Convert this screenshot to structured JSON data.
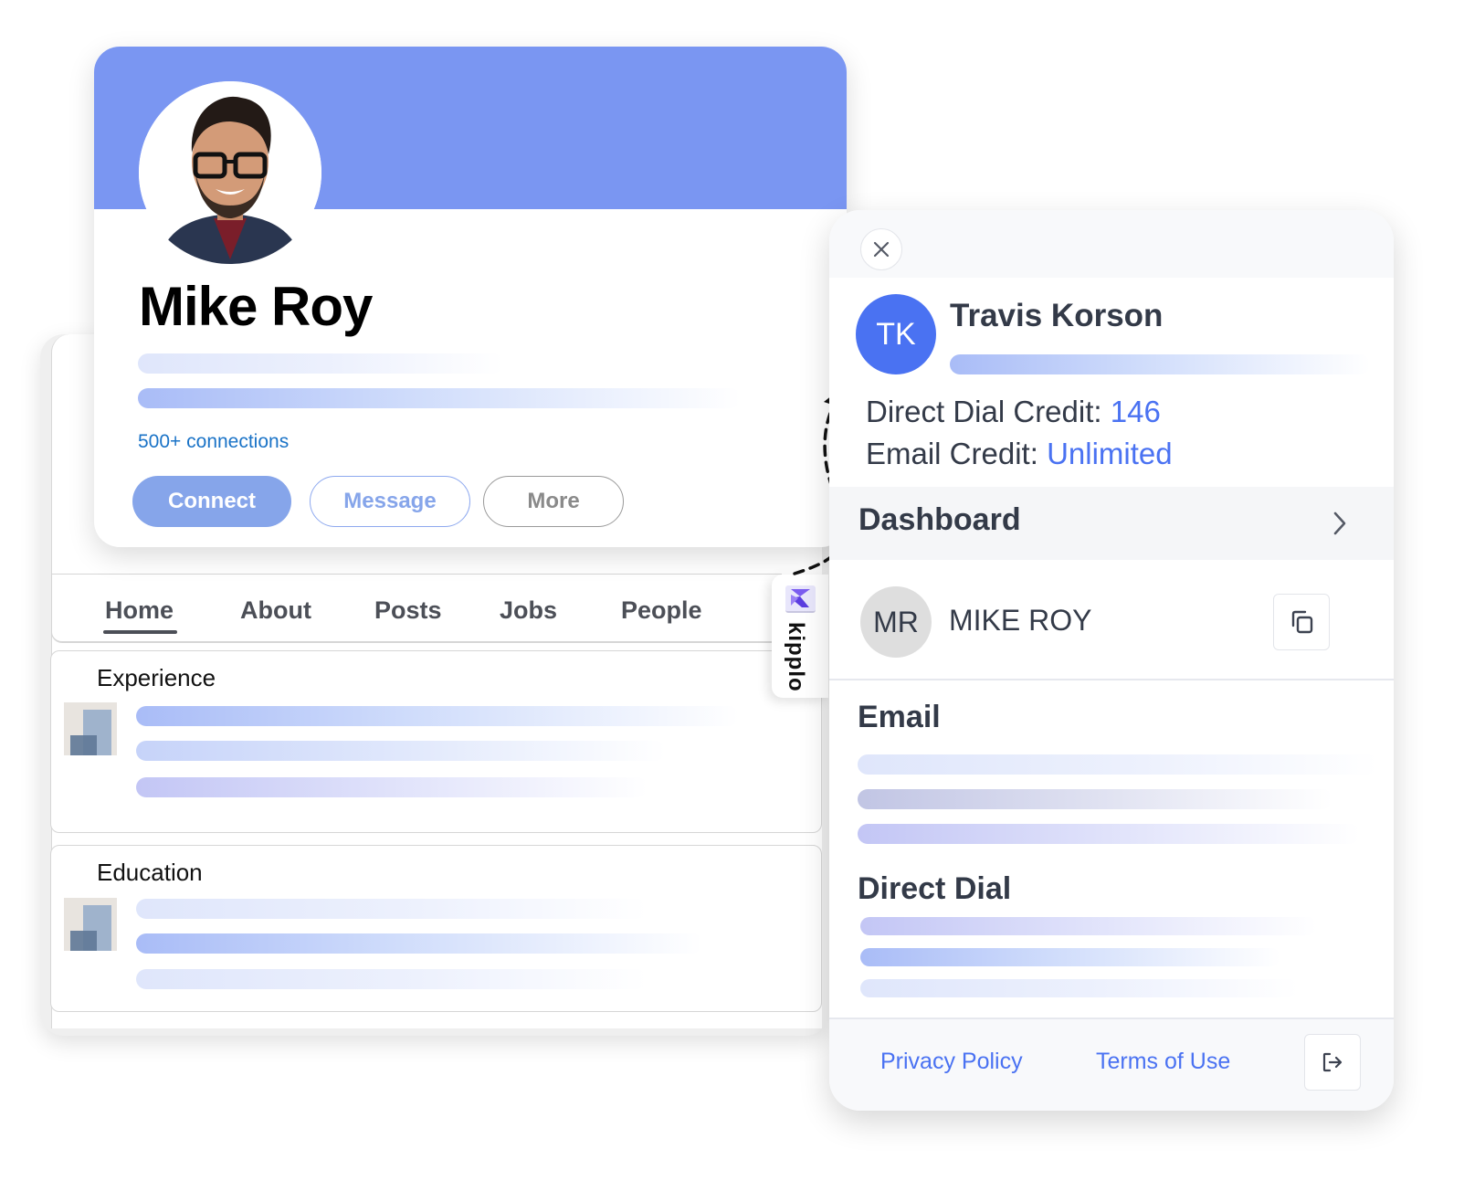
{
  "profile": {
    "name": "Mike Roy",
    "connections": "500+ connections",
    "buttons": {
      "connect": "Connect",
      "message": "Message",
      "more": "More"
    },
    "banner_color": "#7a96f2"
  },
  "nav": {
    "items": [
      {
        "label": "Home",
        "active": true
      },
      {
        "label": "About"
      },
      {
        "label": "Posts"
      },
      {
        "label": "Jobs"
      },
      {
        "label": "People"
      }
    ]
  },
  "sections": {
    "experience": "Experience",
    "education": "Education"
  },
  "extension_tab": {
    "label": "kipplo",
    "icon": "kipplo-logo-icon"
  },
  "panel": {
    "close_icon": "close-icon",
    "user": {
      "initials": "TK",
      "name": "Travis Korson"
    },
    "credits": {
      "direct_dial_label": "Direct Dial Credit:",
      "direct_dial_value": "146",
      "email_label": "Email Credit:",
      "email_value": "Unlimited"
    },
    "dashboard": {
      "label": "Dashboard",
      "icon": "chevron-right-icon"
    },
    "contact": {
      "initials": "MR",
      "name": "MIKE ROY",
      "copy_icon": "copy-icon"
    },
    "fields": {
      "email_title": "Email",
      "direct_dial_title": "Direct Dial"
    },
    "footer": {
      "privacy": "Privacy Policy",
      "terms": "Terms of Use",
      "logout_icon": "logout-icon"
    },
    "accent_color": "#4a72f2"
  }
}
